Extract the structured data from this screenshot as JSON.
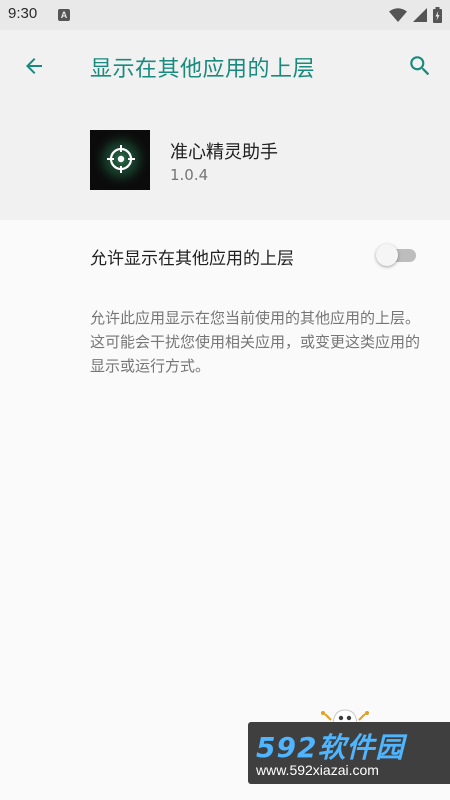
{
  "status_bar": {
    "time": "9:30",
    "notification_icon_letter": "A",
    "icons": [
      "wifi-icon",
      "cell-signal-icon",
      "battery-icon"
    ]
  },
  "app_bar": {
    "title": "显示在其他应用的上层",
    "accent_color": "#1a8a7e",
    "back_icon": "arrow-left-icon",
    "search_icon": "search-icon"
  },
  "app_info": {
    "name": "准心精灵助手",
    "version": "1.0.4",
    "icon": "crosshair-icon"
  },
  "setting": {
    "label": "允许显示在其他应用的上层",
    "enabled": false,
    "description": "允许此应用显示在您当前使用的其他应用的上层。这可能会干扰您使用相关应用，或变更这类应用的显示或运行方式。"
  },
  "watermark": {
    "title": "592软件园",
    "url": "www.592xiazai.com",
    "title_color": "#4fb5ff"
  }
}
